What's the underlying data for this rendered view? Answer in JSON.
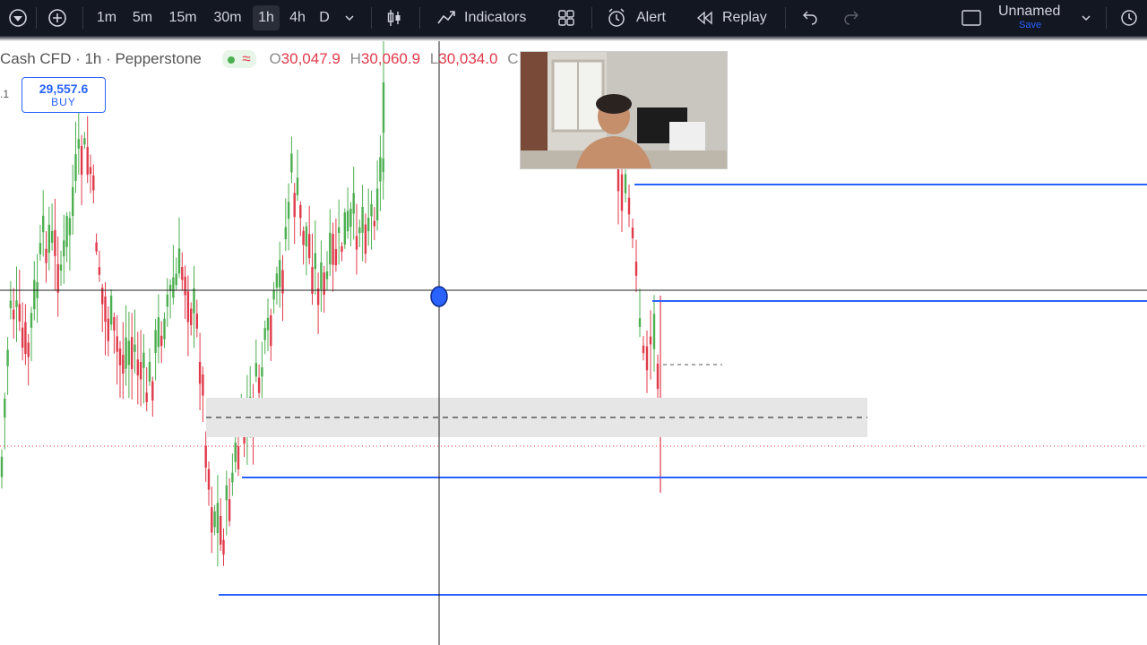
{
  "toolbar": {
    "timeframes": [
      "1m",
      "5m",
      "15m",
      "30m",
      "1h",
      "4h",
      "D"
    ],
    "active_timeframe": "1h",
    "indicators_label": "Indicators",
    "alert_label": "Alert",
    "replay_label": "Replay",
    "layout_name": "Unnamed",
    "save_label": "Save",
    "icons": [
      "logo-icon",
      "add-symbol-icon",
      "chevron-down-icon",
      "candles-icon",
      "indicators-icon",
      "templates-icon",
      "alert-icon",
      "replay-icon",
      "undo-icon",
      "redo-icon",
      "layout-icon",
      "search-icon"
    ]
  },
  "legend": {
    "symbol": "Cash CFD · 1h · Pepperstone",
    "open_label": "O",
    "open_value": "30,047.9",
    "high_label": "H",
    "high_value": "30,060.9",
    "low_label": "L",
    "low_value": "30,034.0",
    "trailing_text": "C"
  },
  "price_marker": {
    "partial": ".1",
    "price": "29,557.6",
    "action": "BUY"
  },
  "colors": {
    "up": "#4caf50",
    "down": "#e03a4a",
    "level_line": "#2962ff",
    "zone": "#e6e6e6",
    "toolbar_bg": "#131722"
  },
  "chart_data": {
    "type": "candlestick",
    "note_levels": [
      "horizontal support/resistance lines",
      "shaded zone",
      "dashed midline"
    ]
  }
}
